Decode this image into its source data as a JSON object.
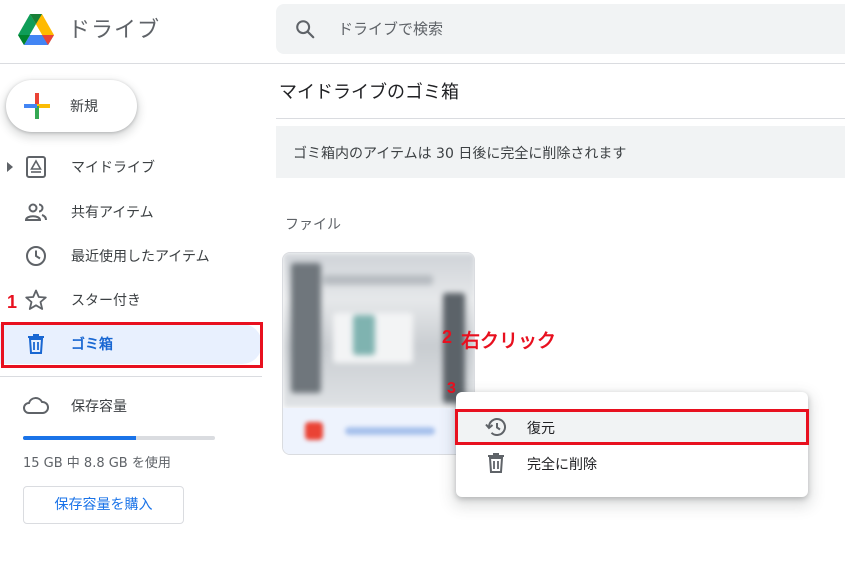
{
  "header": {
    "app_title": "ドライブ",
    "search": {
      "placeholder": "ドライブで検索"
    }
  },
  "sidebar": {
    "new_label": "新規",
    "items": [
      {
        "label": "マイドライブ",
        "icon": "my-drive-icon"
      },
      {
        "label": "共有アイテム",
        "icon": "shared-people-icon"
      },
      {
        "label": "最近使用したアイテム",
        "icon": "clock-icon"
      },
      {
        "label": "スター付き",
        "icon": "star-icon"
      },
      {
        "label": "ゴミ箱",
        "icon": "trash-icon",
        "active": true
      }
    ],
    "storage": {
      "label": "保存容量",
      "usage_text": "15 GB 中 8.8 GB を使用",
      "used_fraction": 0.59,
      "buy_label": "保存容量を購入"
    }
  },
  "main": {
    "title": "マイドライブのゴミ箱",
    "notice": "ゴミ箱内のアイテムは 30 日後に完全に削除されます",
    "section_label": "ファイル"
  },
  "context_menu": {
    "items": [
      {
        "label": "復元",
        "icon": "restore-history-icon"
      },
      {
        "label": "完全に削除",
        "icon": "trash-icon"
      }
    ]
  },
  "annotations": {
    "step1": "1",
    "step2": "2",
    "step2_text": "右クリック",
    "step3": "3"
  },
  "colors": {
    "accent": "#1a73e8",
    "active_bg": "#e8f0fe",
    "annotation_red": "#e8101f"
  }
}
